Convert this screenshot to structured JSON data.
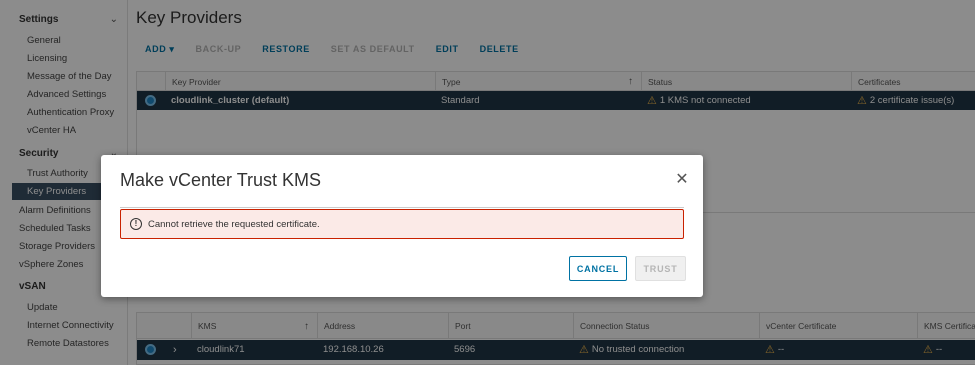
{
  "sidebar": {
    "sections": [
      {
        "label": "Settings",
        "chevron": "chevron-down-icon"
      },
      {
        "label": "Security",
        "chevron": "chevron-down-icon"
      },
      {
        "label": "vSAN"
      }
    ],
    "settings_items": [
      "General",
      "Licensing",
      "Message of the Day",
      "Advanced Settings",
      "Authentication Proxy",
      "vCenter HA"
    ],
    "security_items": [
      "Trust Authority",
      "Key Providers"
    ],
    "top_items": [
      "Alarm Definitions",
      "Scheduled Tasks",
      "Storage Providers",
      "vSphere Zones"
    ],
    "vsan_items": [
      "Update",
      "Internet Connectivity",
      "Remote Datastores"
    ]
  },
  "main": {
    "title": "Key Providers",
    "toolbar": {
      "add": "ADD",
      "backup": "BACK-UP",
      "restore": "RESTORE",
      "set_default": "SET AS DEFAULT",
      "edit": "EDIT",
      "delete": "DELETE"
    },
    "providers_grid": {
      "columns": [
        "Key Provider",
        "Type",
        "Status",
        "Certificates"
      ],
      "rows": [
        {
          "name": "cloudlink_cluster (default)",
          "type": "Standard",
          "status": "1 KMS not connected",
          "certificates": "2 certificate issue(s)"
        }
      ]
    },
    "kms_grid": {
      "columns": [
        "KMS",
        "Address",
        "Port",
        "Connection Status",
        "vCenter Certificate",
        "KMS Certificate"
      ],
      "rows": [
        {
          "kms": "cloudlink71",
          "address": "192.168.10.26",
          "port": "5696",
          "connection_status": "No trusted connection",
          "vcenter_cert": "--",
          "kms_cert": "--"
        }
      ]
    }
  },
  "modal": {
    "title": "Make vCenter Trust KMS",
    "error": "Cannot retrieve the requested certificate.",
    "cancel_label": "CANCEL",
    "trust_label": "TRUST"
  },
  "colors": {
    "accent": "#0072a3",
    "selected_row": "#1f3545",
    "error_border": "#c92100",
    "error_bg": "#fbeae7",
    "warning": "#f2b84b"
  }
}
